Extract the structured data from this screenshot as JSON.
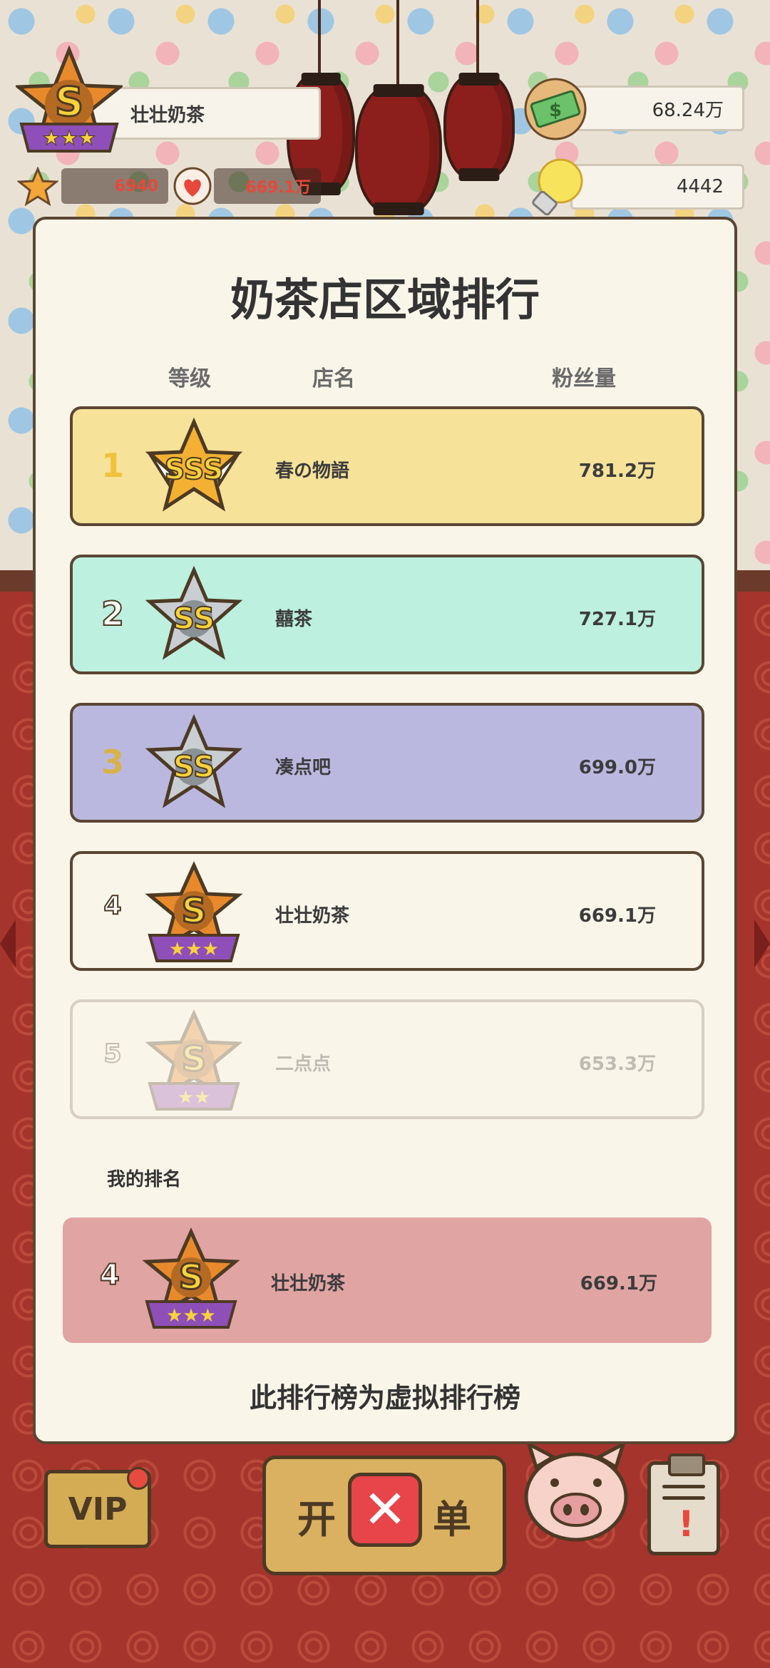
{
  "hud": {
    "shop_name": "壮壮奶茶",
    "rank_letter": "S",
    "stars": "6940",
    "fans": "669.1万",
    "money": "68.24万",
    "ideas": "4442"
  },
  "panel": {
    "title": "奶茶店区域排行",
    "col_level": "等级",
    "col_name": "店名",
    "col_fans": "粉丝量",
    "rows": [
      {
        "rank": "1",
        "grade": "SSS",
        "name": "春の物語",
        "fans": "781.2万",
        "bg": "#f7e29a",
        "rank_color": "#f0c23c"
      },
      {
        "rank": "2",
        "grade": "SS",
        "name": "囍茶",
        "fans": "727.1万",
        "bg": "#bdf0de",
        "rank_color": "#ffffff"
      },
      {
        "rank": "3",
        "grade": "SS",
        "name": "凑点吧",
        "fans": "699.0万",
        "bg": "#bbb8e0",
        "rank_color": "#d8b24a"
      },
      {
        "rank": "4",
        "grade": "S",
        "name": "壮壮奶茶",
        "fans": "669.1万",
        "bg": "#faf5e9",
        "rank_color": "#ffffff"
      },
      {
        "rank": "5",
        "grade": "S",
        "name": "二点点",
        "fans": "653.3万",
        "bg": "#faf5e9",
        "rank_color": "#ffffff"
      }
    ],
    "my_rank_label": "我的排名",
    "my_row": {
      "rank": "4",
      "grade": "S",
      "name": "壮壮奶茶",
      "fans": "669.1万"
    },
    "footnote": "此排行榜为虚拟排行榜"
  },
  "bottom": {
    "vip_label": "VIP",
    "open_left": "开",
    "open_right": "单",
    "close_symbol": "✕"
  }
}
